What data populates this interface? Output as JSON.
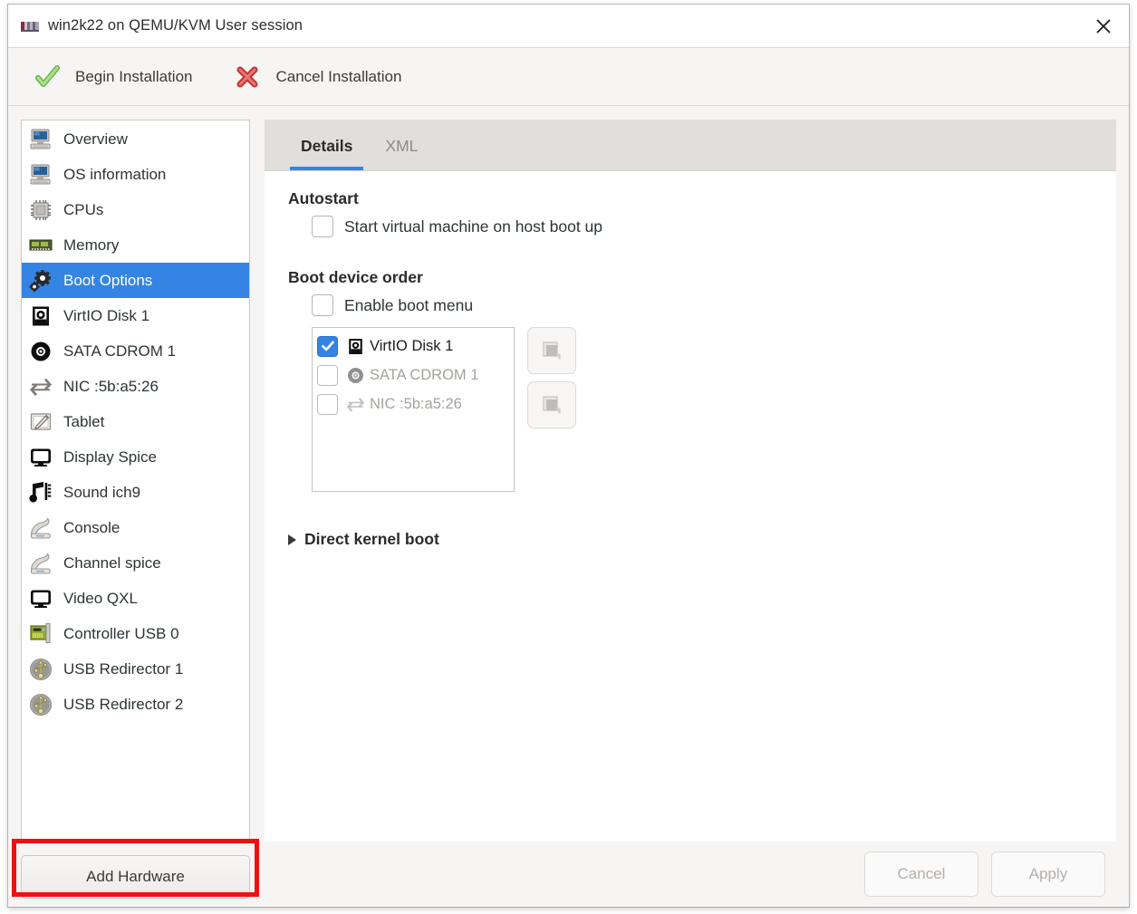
{
  "window": {
    "title": "win2k22 on QEMU/KVM User session",
    "icon": "virt-manager-logo-icon",
    "close_label": "✕"
  },
  "toolbar": {
    "items": [
      {
        "label": "Begin Installation",
        "icon": "green-check-icon"
      },
      {
        "label": "Cancel Installation",
        "icon": "red-x-icon"
      }
    ]
  },
  "sidebar": {
    "items": [
      {
        "label": "Overview",
        "icon": "computer-icon",
        "selected": false
      },
      {
        "label": "OS information",
        "icon": "computer-icon",
        "selected": false
      },
      {
        "label": "CPUs",
        "icon": "cpu-chip-icon",
        "selected": false
      },
      {
        "label": "Memory",
        "icon": "memory-ram-icon",
        "selected": false
      },
      {
        "label": "Boot Options",
        "icon": "gears-icon",
        "selected": true
      },
      {
        "label": "VirtIO Disk 1",
        "icon": "disk-icon",
        "selected": false
      },
      {
        "label": "SATA CDROM 1",
        "icon": "cdrom-icon",
        "selected": false
      },
      {
        "label": "NIC :5b:a5:26",
        "icon": "network-icon",
        "selected": false
      },
      {
        "label": "Tablet",
        "icon": "tablet-icon",
        "selected": false
      },
      {
        "label": "Display Spice",
        "icon": "display-icon",
        "selected": false
      },
      {
        "label": "Sound ich9",
        "icon": "sound-icon",
        "selected": false
      },
      {
        "label": "Console",
        "icon": "console-icon",
        "selected": false
      },
      {
        "label": "Channel spice",
        "icon": "console-icon",
        "selected": false
      },
      {
        "label": "Video QXL",
        "icon": "display-icon",
        "selected": false
      },
      {
        "label": "Controller USB 0",
        "icon": "pci-card-icon",
        "selected": false
      },
      {
        "label": "USB Redirector 1",
        "icon": "usb-icon",
        "selected": false
      },
      {
        "label": "USB Redirector 2",
        "icon": "usb-icon",
        "selected": false
      }
    ],
    "add_hardware_label": "Add Hardware",
    "highlight_color": "#ee1111"
  },
  "tabs": [
    {
      "label": "Details",
      "active": true
    },
    {
      "label": "XML",
      "active": false
    }
  ],
  "details": {
    "autostart": {
      "heading": "Autostart",
      "checkbox_label": "Start virtual machine on host boot up",
      "checked": false
    },
    "boot_order": {
      "heading": "Boot device order",
      "boot_menu_label": "Enable boot menu",
      "boot_menu_checked": false,
      "devices": [
        {
          "label": "VirtIO Disk 1",
          "icon": "disk-icon",
          "checked": true,
          "enabled": true
        },
        {
          "label": "SATA CDROM 1",
          "icon": "cdrom-icon",
          "checked": false,
          "enabled": false
        },
        {
          "label": "NIC :5b:a5:26",
          "icon": "network-icon",
          "checked": false,
          "enabled": false
        }
      ],
      "move_buttons": [
        {
          "icon": "move-up-icon"
        },
        {
          "icon": "move-down-icon"
        }
      ]
    },
    "direct_kernel_boot": {
      "label": "Direct kernel boot",
      "expanded": false,
      "icon": "expander-triangle-icon"
    }
  },
  "footer": {
    "cancel_label": "Cancel",
    "apply_label": "Apply",
    "cancel_enabled": false,
    "apply_enabled": false
  },
  "colors": {
    "selection_blue": "#3584e4",
    "tab_underline": "#3584e4",
    "highlight_red": "#ee1111",
    "window_bg": "#f6f5f4"
  }
}
